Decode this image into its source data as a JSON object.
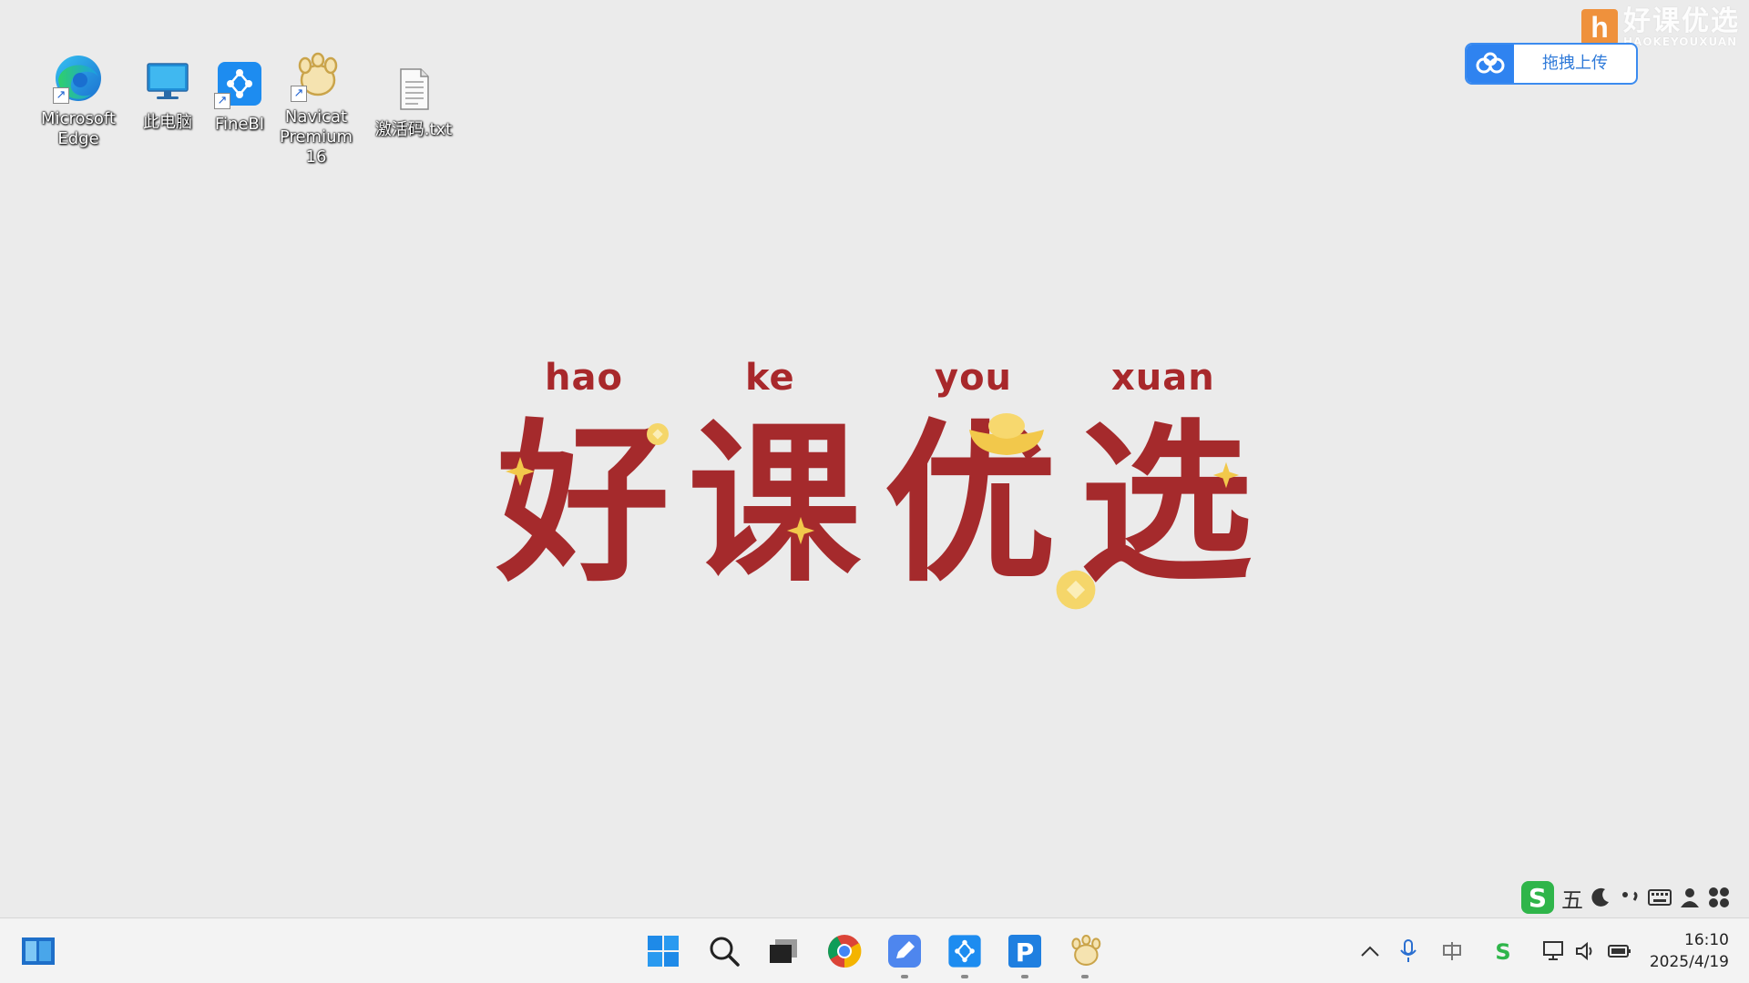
{
  "desktop": {
    "icons": [
      {
        "label": "Microsoft Edge",
        "icon": "edge-icon"
      },
      {
        "label": "此电脑",
        "icon": "this-pc-icon"
      },
      {
        "label": "FineBI",
        "icon": "finebi-icon"
      },
      {
        "label": "Navicat Premium 16",
        "icon": "navicat-icon"
      },
      {
        "label": "激活码.txt",
        "icon": "text-file-icon"
      }
    ]
  },
  "watermark": {
    "cn": "好课优选",
    "en": "HAOKEYOUXUAN"
  },
  "upload_widget": {
    "label": "拖拽上传",
    "icon": "cloud-upload-icon"
  },
  "brand": {
    "pinyin": [
      "hao",
      "ke",
      "you",
      "xuan"
    ],
    "characters": [
      "好",
      "课",
      "优",
      "选"
    ],
    "color": "#a52a2c",
    "accent": "#f2c84b"
  },
  "ime": {
    "mode": "五",
    "icons": [
      "sogou-icon",
      "moon-icon",
      "punctuation-icon",
      "keyboard-icon",
      "user-icon",
      "apps-icon"
    ]
  },
  "taskbar": {
    "pinned": [
      "widgets-icon",
      "start-icon",
      "search-icon",
      "task-view-icon",
      "chrome-icon",
      "edit-app-icon",
      "finebi-icon",
      "p-app-icon",
      "navicat-icon"
    ],
    "tray": [
      "chevron-up-icon",
      "microphone-icon",
      "ime-zh-icon",
      "sogou-tray-icon",
      "display-icon",
      "volume-icon",
      "battery-icon"
    ]
  },
  "clock": {
    "time": "16:10",
    "date": "2025/4/19"
  }
}
